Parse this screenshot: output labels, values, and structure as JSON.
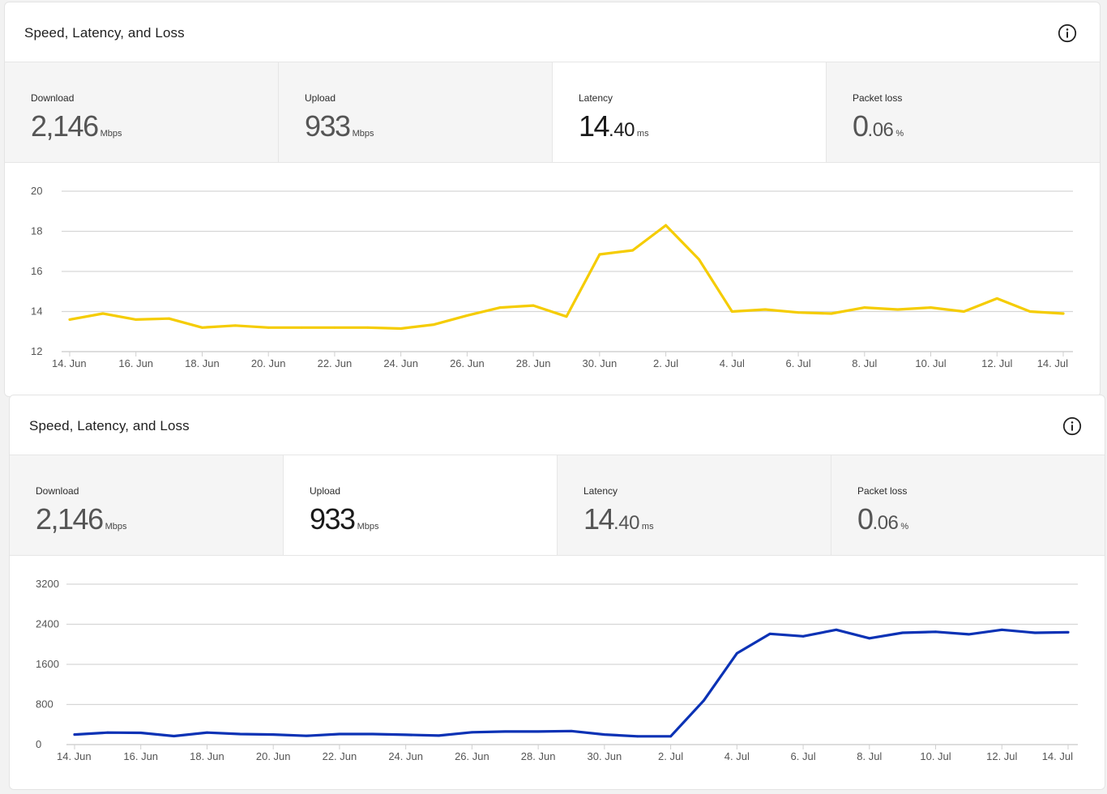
{
  "panels": [
    {
      "title": "Speed, Latency, and Loss",
      "icon": "info-icon",
      "metrics": [
        {
          "label": "Download",
          "int": "2,146",
          "dec": "",
          "unit": "Mbps"
        },
        {
          "label": "Upload",
          "int": "933",
          "dec": "",
          "unit": "Mbps"
        },
        {
          "label": "Latency",
          "int": "14",
          "dec": ".40",
          "unit": "ms"
        },
        {
          "label": "Packet loss",
          "int": "0",
          "dec": ".06",
          "unit": "%"
        }
      ],
      "selected_metric": "Latency"
    },
    {
      "title": "Speed, Latency, and Loss",
      "icon": "info-icon",
      "metrics": [
        {
          "label": "Download",
          "int": "2,146",
          "dec": "",
          "unit": "Mbps"
        },
        {
          "label": "Upload",
          "int": "933",
          "dec": "",
          "unit": "Mbps"
        },
        {
          "label": "Latency",
          "int": "14",
          "dec": ".40",
          "unit": "ms"
        },
        {
          "label": "Packet loss",
          "int": "0",
          "dec": ".06",
          "unit": "%"
        }
      ],
      "selected_metric": "Upload"
    }
  ],
  "chart_data": [
    {
      "type": "line",
      "title": "",
      "xlabel": "",
      "ylabel": "",
      "line_color": "#f5cc00",
      "x": [
        "14. Jun",
        "15. Jun",
        "16. Jun",
        "17. Jun",
        "18. Jun",
        "19. Jun",
        "20. Jun",
        "21. Jun",
        "22. Jun",
        "23. Jun",
        "24. Jun",
        "25. Jun",
        "26. Jun",
        "27. Jun",
        "28. Jun",
        "29. Jun",
        "30. Jun",
        "1. Jul",
        "2. Jul",
        "3. Jul",
        "4. Jul",
        "5. Jul",
        "6. Jul",
        "7. Jul",
        "8. Jul",
        "9. Jul",
        "10. Jul",
        "11. Jul",
        "12. Jul",
        "13. Jul",
        "14. Jul"
      ],
      "x_tick_labels": [
        "14. Jun",
        "16. Jun",
        "18. Jun",
        "20. Jun",
        "22. Jun",
        "24. Jun",
        "26. Jun",
        "28. Jun",
        "30. Jun",
        "2. Jul",
        "4. Jul",
        "6. Jul",
        "8. Jul",
        "10. Jul",
        "12. Jul",
        "14. Jul"
      ],
      "y_ticks": [
        12,
        14,
        16,
        18,
        20
      ],
      "ylim": [
        12,
        20
      ],
      "grid": true,
      "values": [
        13.6,
        13.9,
        13.6,
        13.65,
        13.2,
        13.3,
        13.2,
        13.2,
        13.2,
        13.2,
        13.15,
        13.35,
        13.8,
        14.2,
        14.3,
        13.75,
        16.85,
        17.05,
        18.3,
        16.6,
        14.0,
        14.1,
        13.95,
        13.9,
        14.2,
        14.1,
        14.2,
        14.0,
        14.65,
        14.0,
        13.9
      ]
    },
    {
      "type": "line",
      "title": "",
      "xlabel": "",
      "ylabel": "",
      "line_color": "#0b32b5",
      "x": [
        "14. Jun",
        "15. Jun",
        "16. Jun",
        "17. Jun",
        "18. Jun",
        "19. Jun",
        "20. Jun",
        "21. Jun",
        "22. Jun",
        "23. Jun",
        "24. Jun",
        "25. Jun",
        "26. Jun",
        "27. Jun",
        "28. Jun",
        "29. Jun",
        "30. Jun",
        "1. Jul",
        "2. Jul",
        "3. Jul",
        "4. Jul",
        "5. Jul",
        "6. Jul",
        "7. Jul",
        "8. Jul",
        "9. Jul",
        "10. Jul",
        "11. Jul",
        "12. Jul",
        "13. Jul",
        "14. Jul"
      ],
      "x_tick_labels": [
        "14. Jun",
        "16. Jun",
        "18. Jun",
        "20. Jun",
        "22. Jun",
        "24. Jun",
        "26. Jun",
        "28. Jun",
        "30. Jun",
        "2. Jul",
        "4. Jul",
        "6. Jul",
        "8. Jul",
        "10. Jul",
        "12. Jul",
        "14. Jul"
      ],
      "y_ticks": [
        0,
        800,
        1600,
        2400,
        3200
      ],
      "ylim": [
        0,
        3200
      ],
      "grid": true,
      "values": [
        200,
        240,
        235,
        170,
        240,
        210,
        200,
        175,
        210,
        210,
        195,
        180,
        245,
        260,
        260,
        270,
        200,
        165,
        165,
        880,
        1820,
        2210,
        2160,
        2290,
        2120,
        2230,
        2250,
        2200,
        2290,
        2230,
        2240
      ]
    }
  ]
}
